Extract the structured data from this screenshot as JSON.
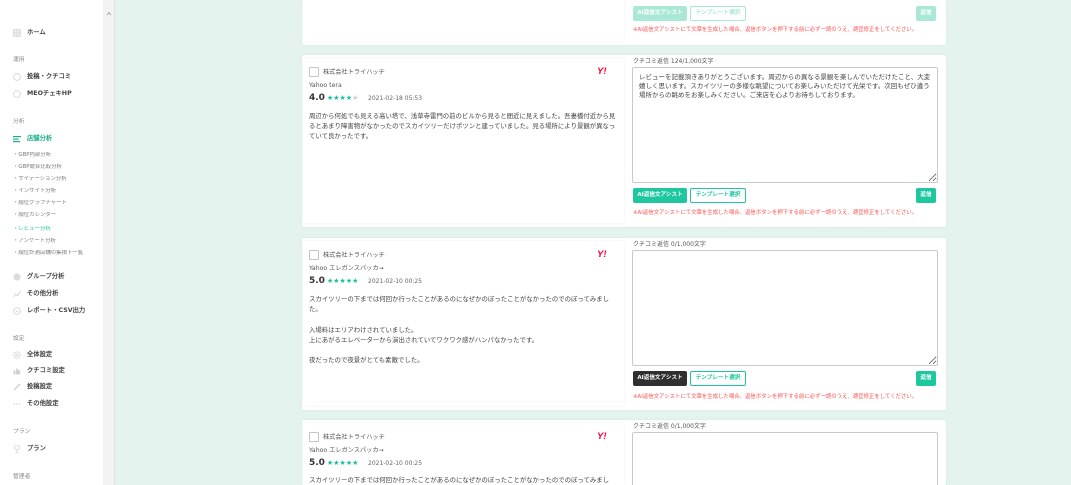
{
  "colors": {
    "background": "#e4f3ee",
    "accent": "#1fc7a0",
    "accent_disabled": "#a9e8d6",
    "active_nav": "#18b08a",
    "note_red": "#ff4d4d",
    "ai_button_hover": "#2f2f2f",
    "yahoo_red": "#ff0033",
    "star": "#1bbf9a"
  },
  "sidebar": {
    "home": {
      "label": "ホーム",
      "icon": "home-icon"
    },
    "section_operation": "運用",
    "posts_reviews": {
      "label": "投稿・クチコミ",
      "icon": "circle-icon"
    },
    "meo_hp": {
      "label": "MEOチェキHP",
      "icon": "circle-icon"
    },
    "section_analysis": "分析",
    "store_analysis": {
      "label": "店舗分析",
      "icon": "bars-icon",
      "active": true
    },
    "store_sub_items": [
      "・GBP内部分析",
      "・GBP競合比較分析",
      "・サイテーション分析",
      "・インサイト分析",
      "・順位グラフチャート",
      "・順位カレンダー",
      "・レビュー分析",
      "・アンケート分析",
      "・順位計測店舗の集積下一覧"
    ],
    "group_analysis": {
      "label": "グループ分析",
      "icon": "group-icon"
    },
    "other_analysis": {
      "label": "その他分析",
      "icon": "chart-icon"
    },
    "report_csv": {
      "label": "レポート・CSV出力",
      "icon": "report-icon"
    },
    "section_settings": "設定",
    "general_settings": {
      "label": "全体設定",
      "icon": "gear-icon"
    },
    "review_settings": {
      "label": "クチコミ設定",
      "icon": "thumbs-up-icon"
    },
    "post_settings": {
      "label": "投稿設定",
      "icon": "pencil-icon"
    },
    "other_settings": {
      "label": "その他設定",
      "icon": "dots-icon"
    },
    "section_plan": "プラン",
    "plan": {
      "label": "プラン",
      "icon": "trophy-icon"
    },
    "section_admin": "管理者"
  },
  "cards": [
    {
      "state": "disabled",
      "ai_assist_button": "AI返信文アシスト",
      "template_button": "テンプレート選択",
      "reply_button": "返信",
      "note": "※AI返信文アシストにて文章を生成した場合、返信ボタンを押下する前に必ず一読のうえ、適宜修正をしてください。"
    },
    {
      "company": "株式会社トライハッチ",
      "platform_logo": "Y!",
      "reviewer": "Yahoo tera",
      "rating": "4.0",
      "stars": {
        "filled": "★★★★",
        "empty": "★"
      },
      "date": "2021-02-18 05:53",
      "review_text": "周辺から何処でも見える高い塔で、浅草寺雷門の前のビルから見ると間近に見えました。吾妻橋付近から見るとあまり障害物がなかったのでスカイツリーだけポツンと建っていました。見る場所により景観が異なっていて良かったです。",
      "reply_counter": "クチコミ返信 124/1,000文字",
      "reply_text": "レビューを記載頂きありがとうございます。周辺からの異なる景観を楽しんでいただけたこと、大変嬉しく思います。スカイツリーの多様な眺望についてお楽しみいただけて光栄です。次回もぜひ違う場所からの眺めをお楽しみください。ご来店を心よりお待ちしております。",
      "ai_assist_button": "AI返信文アシスト",
      "template_button": "テンプレート選択",
      "reply_button": "返信",
      "note": "※AI返信文アシストにて文章を生成した場合、返信ボタンを押下する前に必ず一読のうえ、適宜修正をしてください。"
    },
    {
      "company": "株式会社トライハッチ",
      "platform_logo": "Y!",
      "reviewer": "Yahoo エレガンスパッカ→",
      "rating": "5.0",
      "stars": {
        "filled": "★★★★★",
        "empty": ""
      },
      "date": "2021-02-10 00:25",
      "review_text": "スカイツリーの下までは何回か行ったことがあるのになぜかのぼったことがなかったのでのぼってみました。\n\n入場料はエリアわけされていました。\n上にあがるエレベーターから演出されていてワクワク感がハンパなかったです。\n\n夜だったので夜景がとても素敵でした。",
      "reply_counter": "クチコミ返信 0/1,000文字",
      "reply_text": "",
      "ai_assist_button": "AI返信文アシスト",
      "template_button": "テンプレート選択",
      "reply_button": "返信",
      "note": "※AI返信文アシストにて文章を生成した場合、返信ボタンを押下する前に必ず一読のうえ、適宜修正をしてください。"
    },
    {
      "company": "株式会社トライハッチ",
      "platform_logo": "Y!",
      "reviewer": "Yahoo エレガンスパッカ→",
      "rating": "5.0",
      "stars": {
        "filled": "★★★★★",
        "empty": ""
      },
      "date": "2021-02-10 00:25",
      "review_text": "スカイツリーの下までは何回か行ったことがあるのになぜかのぼったことがなかったのでのぼってみまし",
      "reply_counter": "クチコミ返信 0/1,000文字",
      "reply_text": ""
    }
  ]
}
